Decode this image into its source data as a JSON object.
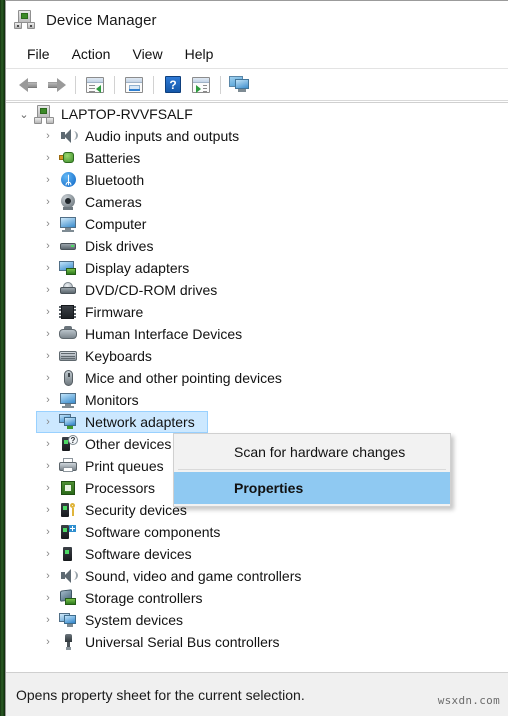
{
  "window": {
    "title": "Device Manager",
    "icon": "device-manager-icon"
  },
  "menubar": {
    "items": [
      {
        "label": "File"
      },
      {
        "label": "Action"
      },
      {
        "label": "View"
      },
      {
        "label": "Help"
      }
    ]
  },
  "toolbar": {
    "buttons": [
      {
        "icon": "back-arrow-icon",
        "label": "Back"
      },
      {
        "icon": "forward-arrow-icon",
        "label": "Forward"
      },
      {
        "icon": "show-hide-console-tree-icon",
        "label": "Show/Hide Console Tree"
      },
      {
        "icon": "properties-icon",
        "label": "Properties"
      },
      {
        "icon": "help-icon",
        "label": "Help"
      },
      {
        "icon": "update-driver-icon",
        "label": "Update Driver Software"
      },
      {
        "icon": "scan-hardware-changes-icon",
        "label": "Scan for hardware changes"
      }
    ],
    "help_glyph": "?"
  },
  "tree": {
    "root": {
      "label": "LAPTOP-RVVFSALF",
      "icon": "computer-root-icon",
      "chevron": "chevron-down",
      "expanded": true
    },
    "items": [
      {
        "label": "Audio inputs and outputs",
        "icon": "speaker-icon"
      },
      {
        "label": "Batteries",
        "icon": "battery-icon"
      },
      {
        "label": "Bluetooth",
        "icon": "bluetooth-icon",
        "glyph": "ᛦ"
      },
      {
        "label": "Cameras",
        "icon": "camera-icon"
      },
      {
        "label": "Computer",
        "icon": "computer-icon"
      },
      {
        "label": "Disk drives",
        "icon": "disk-drive-icon"
      },
      {
        "label": "Display adapters",
        "icon": "display-adapter-icon"
      },
      {
        "label": "DVD/CD-ROM drives",
        "icon": "dvd-drive-icon"
      },
      {
        "label": "Firmware",
        "icon": "firmware-icon"
      },
      {
        "label": "Human Interface Devices",
        "icon": "hid-icon"
      },
      {
        "label": "Keyboards",
        "icon": "keyboard-icon"
      },
      {
        "label": "Mice and other pointing devices",
        "icon": "mouse-icon"
      },
      {
        "label": "Monitors",
        "icon": "monitor-icon"
      },
      {
        "label": "Network adapters",
        "icon": "network-adapter-icon",
        "selected": true
      },
      {
        "label": "Other devices",
        "icon": "other-device-icon",
        "glyph": "?"
      },
      {
        "label": "Print queues",
        "icon": "printer-icon"
      },
      {
        "label": "Processors",
        "icon": "processor-icon"
      },
      {
        "label": "Security devices",
        "icon": "security-device-icon"
      },
      {
        "label": "Software components",
        "icon": "software-component-icon"
      },
      {
        "label": "Software devices",
        "icon": "software-device-icon"
      },
      {
        "label": "Sound, video and game controllers",
        "icon": "sound-controller-icon"
      },
      {
        "label": "Storage controllers",
        "icon": "storage-controller-icon"
      },
      {
        "label": "System devices",
        "icon": "system-device-icon"
      },
      {
        "label": "Universal Serial Bus controllers",
        "icon": "usb-controller-icon"
      }
    ],
    "chevron_collapsed": "›"
  },
  "context_menu": {
    "items": [
      {
        "label": "Scan for hardware changes",
        "highlighted": false
      },
      {
        "label": "Properties",
        "highlighted": true
      }
    ]
  },
  "status_bar": {
    "text": "Opens property sheet for the current selection."
  },
  "watermark": {
    "text": "wsxdn.com"
  },
  "colors": {
    "selection_blue": "#cce8ff",
    "menu_highlight_blue": "#8fc9f2",
    "window_bg": "#ffffff",
    "status_bg": "#f0f0f0",
    "desktop_green": "#1d3a1d"
  }
}
